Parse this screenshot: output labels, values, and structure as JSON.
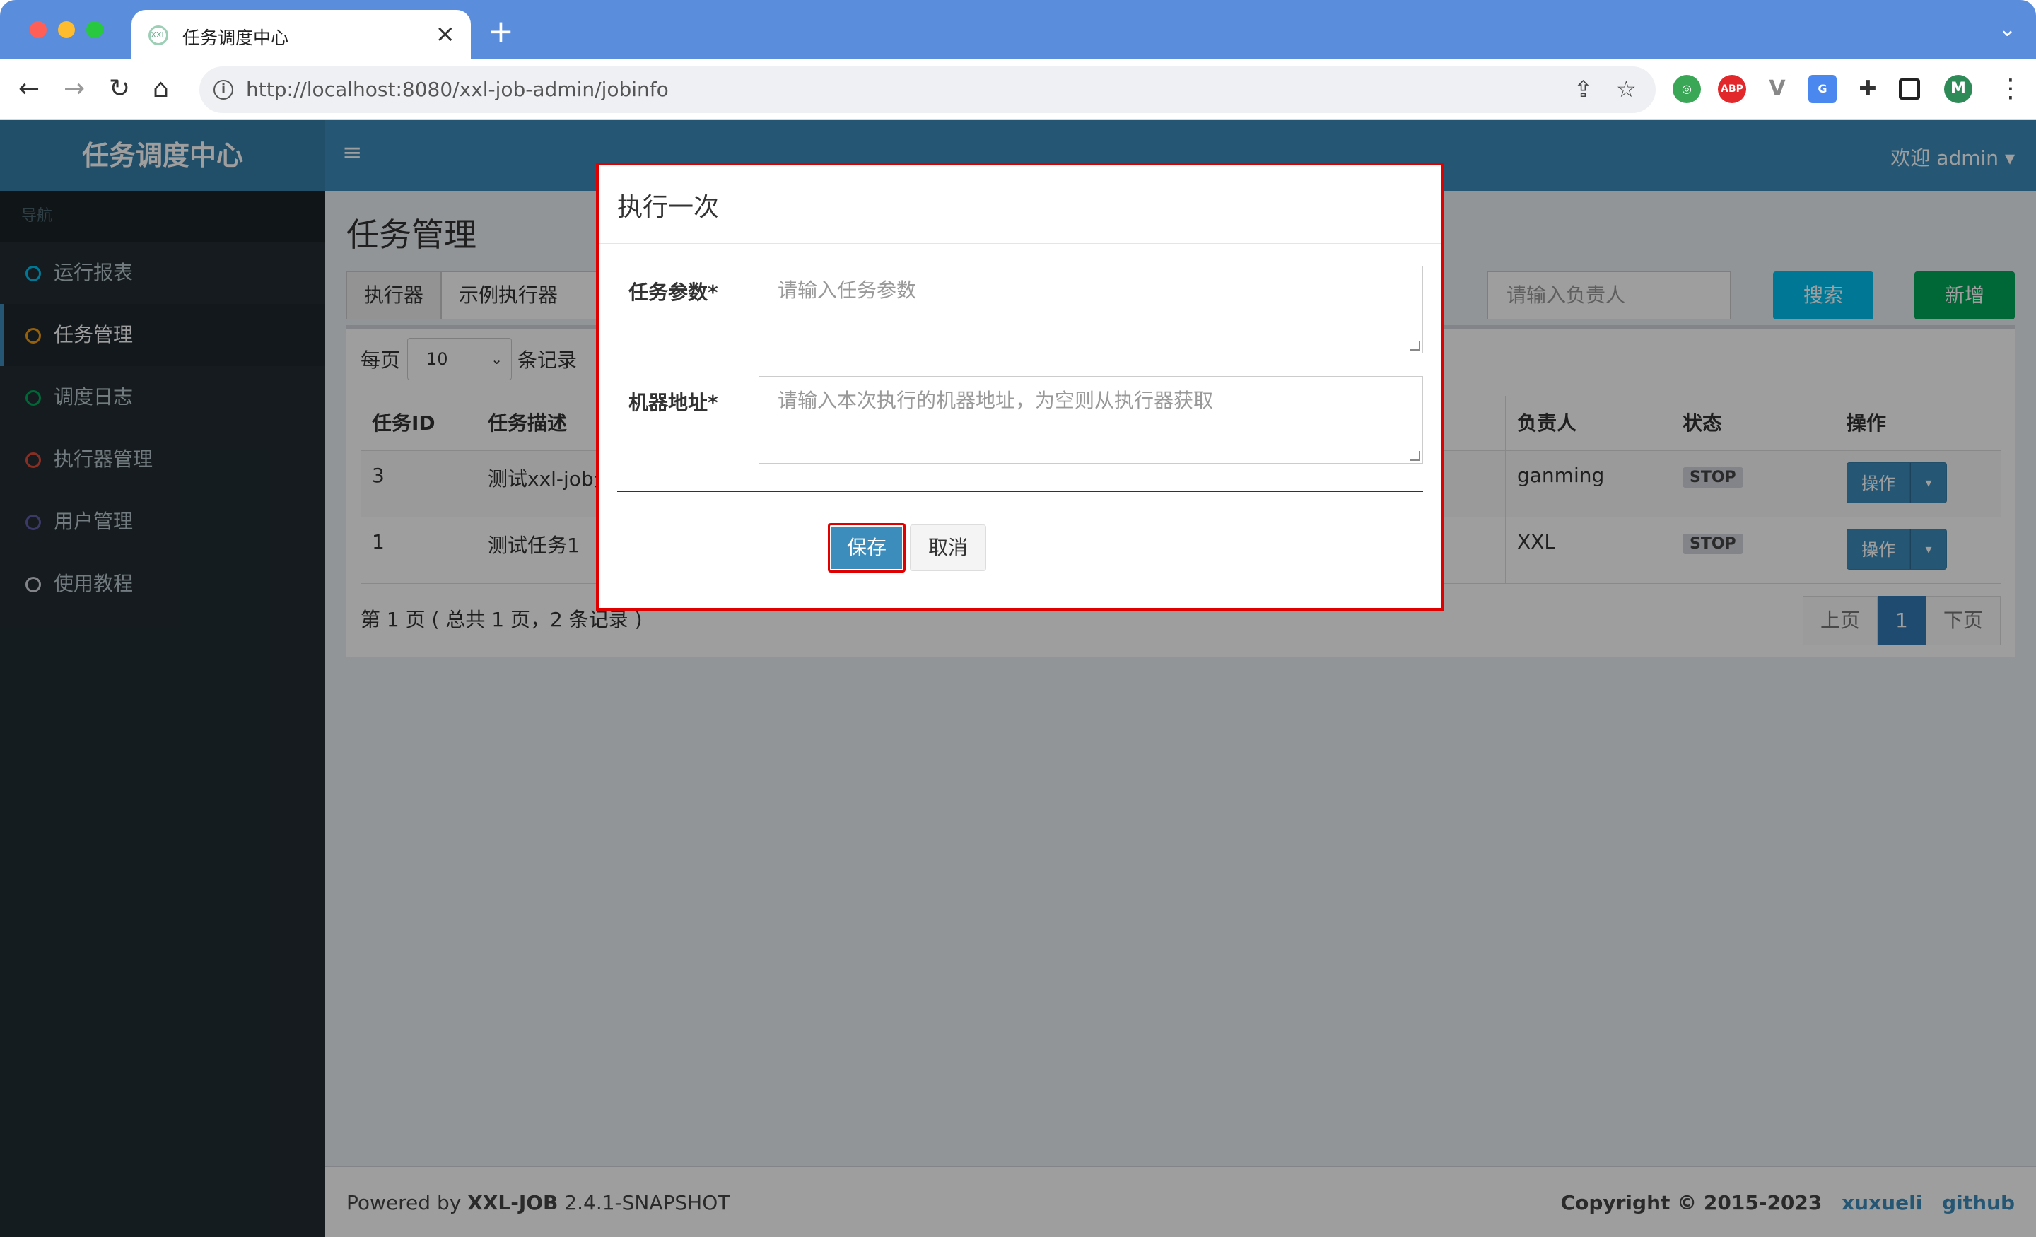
{
  "browser": {
    "tab_title": "任务调度中心",
    "favicon_text": "XXL",
    "tab_close": "×",
    "new_tab": "+",
    "tab_menu": "⌄",
    "url": "http://localhost:8080/xxl-job-admin/jobinfo",
    "back": "←",
    "forward": "→",
    "reload": "↻",
    "home": "⌂",
    "share": "⇪",
    "star": "☆",
    "extensions": [
      "globe-ext",
      "ABP",
      "V",
      "translate-ext",
      "puzzle",
      "sidepanel"
    ],
    "profile_initial": "M",
    "menu": "⋮"
  },
  "app": {
    "logo": "任务调度中心",
    "hamburger": "≡",
    "user": "欢迎 admin ▾"
  },
  "sidebar": {
    "header": "导航",
    "items": [
      {
        "label": "运行报表",
        "color": "#00c0ef"
      },
      {
        "label": "任务管理",
        "color": "#f39c12"
      },
      {
        "label": "调度日志",
        "color": "#00a65a"
      },
      {
        "label": "执行器管理",
        "color": "#dd4b39"
      },
      {
        "label": "用户管理",
        "color": "#605ca8"
      },
      {
        "label": "使用教程",
        "color": "#d2d6de"
      }
    ]
  },
  "main": {
    "title": "任务管理",
    "filter_label": "执行器",
    "filter_value": "示例执行器",
    "author_placeholder": "请输入负责人",
    "search_button": "搜索",
    "add_button": "新增",
    "per_page_label": "每页",
    "per_page_value": "10",
    "per_page_suffix": "条记录",
    "table": {
      "headers": [
        "任务ID",
        "任务描述",
        "",
        "负责人",
        "状态",
        "操作"
      ],
      "rows": [
        {
          "id": "3",
          "desc": "测试xxl-job元",
          "owner": "ganming",
          "status": "STOP",
          "action": "操作"
        },
        {
          "id": "1",
          "desc": "测试任务1",
          "owner": "XXL",
          "status": "STOP",
          "action": "操作"
        }
      ]
    },
    "page_info": "第 1 页 ( 总共 1 页，2 条记录 )",
    "pager": {
      "prev": "上页",
      "current": "1",
      "next": "下页"
    }
  },
  "footer": {
    "powered_prefix": "Powered by ",
    "brand": "XXL-JOB",
    "version": " 2.4.1-SNAPSHOT",
    "copyright": "Copyright © 2015-2023",
    "link1": "xuxueli",
    "link2": "github"
  },
  "modal": {
    "title": "执行一次",
    "param_label": "任务参数*",
    "param_placeholder": "请输入任务参数",
    "address_label": "机器地址*",
    "address_placeholder": "请输入本次执行的机器地址，为空则从执行器获取",
    "save_button": "保存",
    "cancel_button": "取消",
    "highlight_color": "#e00000"
  }
}
